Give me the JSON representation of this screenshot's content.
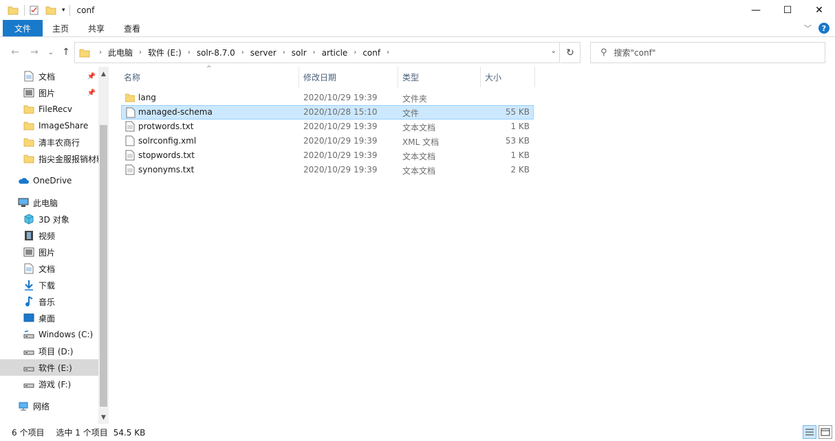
{
  "window": {
    "title": "conf",
    "minimize": "—",
    "maximize": "☐",
    "close": "✕"
  },
  "ribbon": {
    "tabs": [
      "文件",
      "主页",
      "共享",
      "查看"
    ],
    "expand": "﹀",
    "help": "?"
  },
  "nav": {
    "back": "←",
    "forward": "→",
    "recent": "⌄",
    "up": "↑"
  },
  "address": {
    "crumbs": [
      "此电脑",
      "软件 (E:)",
      "solr-8.7.0",
      "server",
      "solr",
      "article",
      "conf"
    ],
    "refresh": "↻"
  },
  "search": {
    "placeholder": "搜索\"conf\""
  },
  "sidebar": {
    "quick_items": [
      {
        "label": "文档",
        "icon": "document-icon",
        "pinned": true
      },
      {
        "label": "图片",
        "icon": "picture-icon",
        "pinned": true
      },
      {
        "label": "FileRecv",
        "icon": "folder-icon",
        "pinned": false
      },
      {
        "label": "ImageShare",
        "icon": "folder-icon",
        "pinned": false
      },
      {
        "label": "清丰农商行",
        "icon": "folder-icon",
        "pinned": false
      },
      {
        "label": "指尖金服报销材料",
        "icon": "folder-icon",
        "pinned": false
      }
    ],
    "onedrive": "OneDrive",
    "thispc": "此电脑",
    "pc_items": [
      {
        "label": "3D 对象",
        "icon": "cube-icon"
      },
      {
        "label": "视频",
        "icon": "video-icon"
      },
      {
        "label": "图片",
        "icon": "picture-icon"
      },
      {
        "label": "文档",
        "icon": "document-icon"
      },
      {
        "label": "下载",
        "icon": "download-icon"
      },
      {
        "label": "音乐",
        "icon": "music-icon"
      },
      {
        "label": "桌面",
        "icon": "desktop-icon"
      },
      {
        "label": "Windows (C:)",
        "icon": "drive-icon"
      },
      {
        "label": "项目 (D:)",
        "icon": "drive-icon"
      },
      {
        "label": "软件 (E:)",
        "icon": "drive-icon",
        "selected": true
      },
      {
        "label": "游戏 (F:)",
        "icon": "drive-icon"
      }
    ],
    "network": "网络"
  },
  "columns": {
    "name": "名称",
    "modified": "修改日期",
    "type": "类型",
    "size": "大小"
  },
  "files": [
    {
      "name": "lang",
      "modified": "2020/10/29 19:39",
      "type": "文件夹",
      "size": "",
      "kind": "folder"
    },
    {
      "name": "managed-schema",
      "modified": "2020/10/28 15:10",
      "type": "文件",
      "size": "55 KB",
      "kind": "file",
      "selected": true
    },
    {
      "name": "protwords.txt",
      "modified": "2020/10/29 19:39",
      "type": "文本文档",
      "size": "1 KB",
      "kind": "text"
    },
    {
      "name": "solrconfig.xml",
      "modified": "2020/10/29 19:39",
      "type": "XML 文档",
      "size": "53 KB",
      "kind": "file"
    },
    {
      "name": "stopwords.txt",
      "modified": "2020/10/29 19:39",
      "type": "文本文档",
      "size": "1 KB",
      "kind": "text"
    },
    {
      "name": "synonyms.txt",
      "modified": "2020/10/29 19:39",
      "type": "文本文档",
      "size": "2 KB",
      "kind": "text"
    }
  ],
  "status": {
    "count": "6 个项目",
    "selection": "选中 1 个项目",
    "size": "54.5 KB"
  }
}
